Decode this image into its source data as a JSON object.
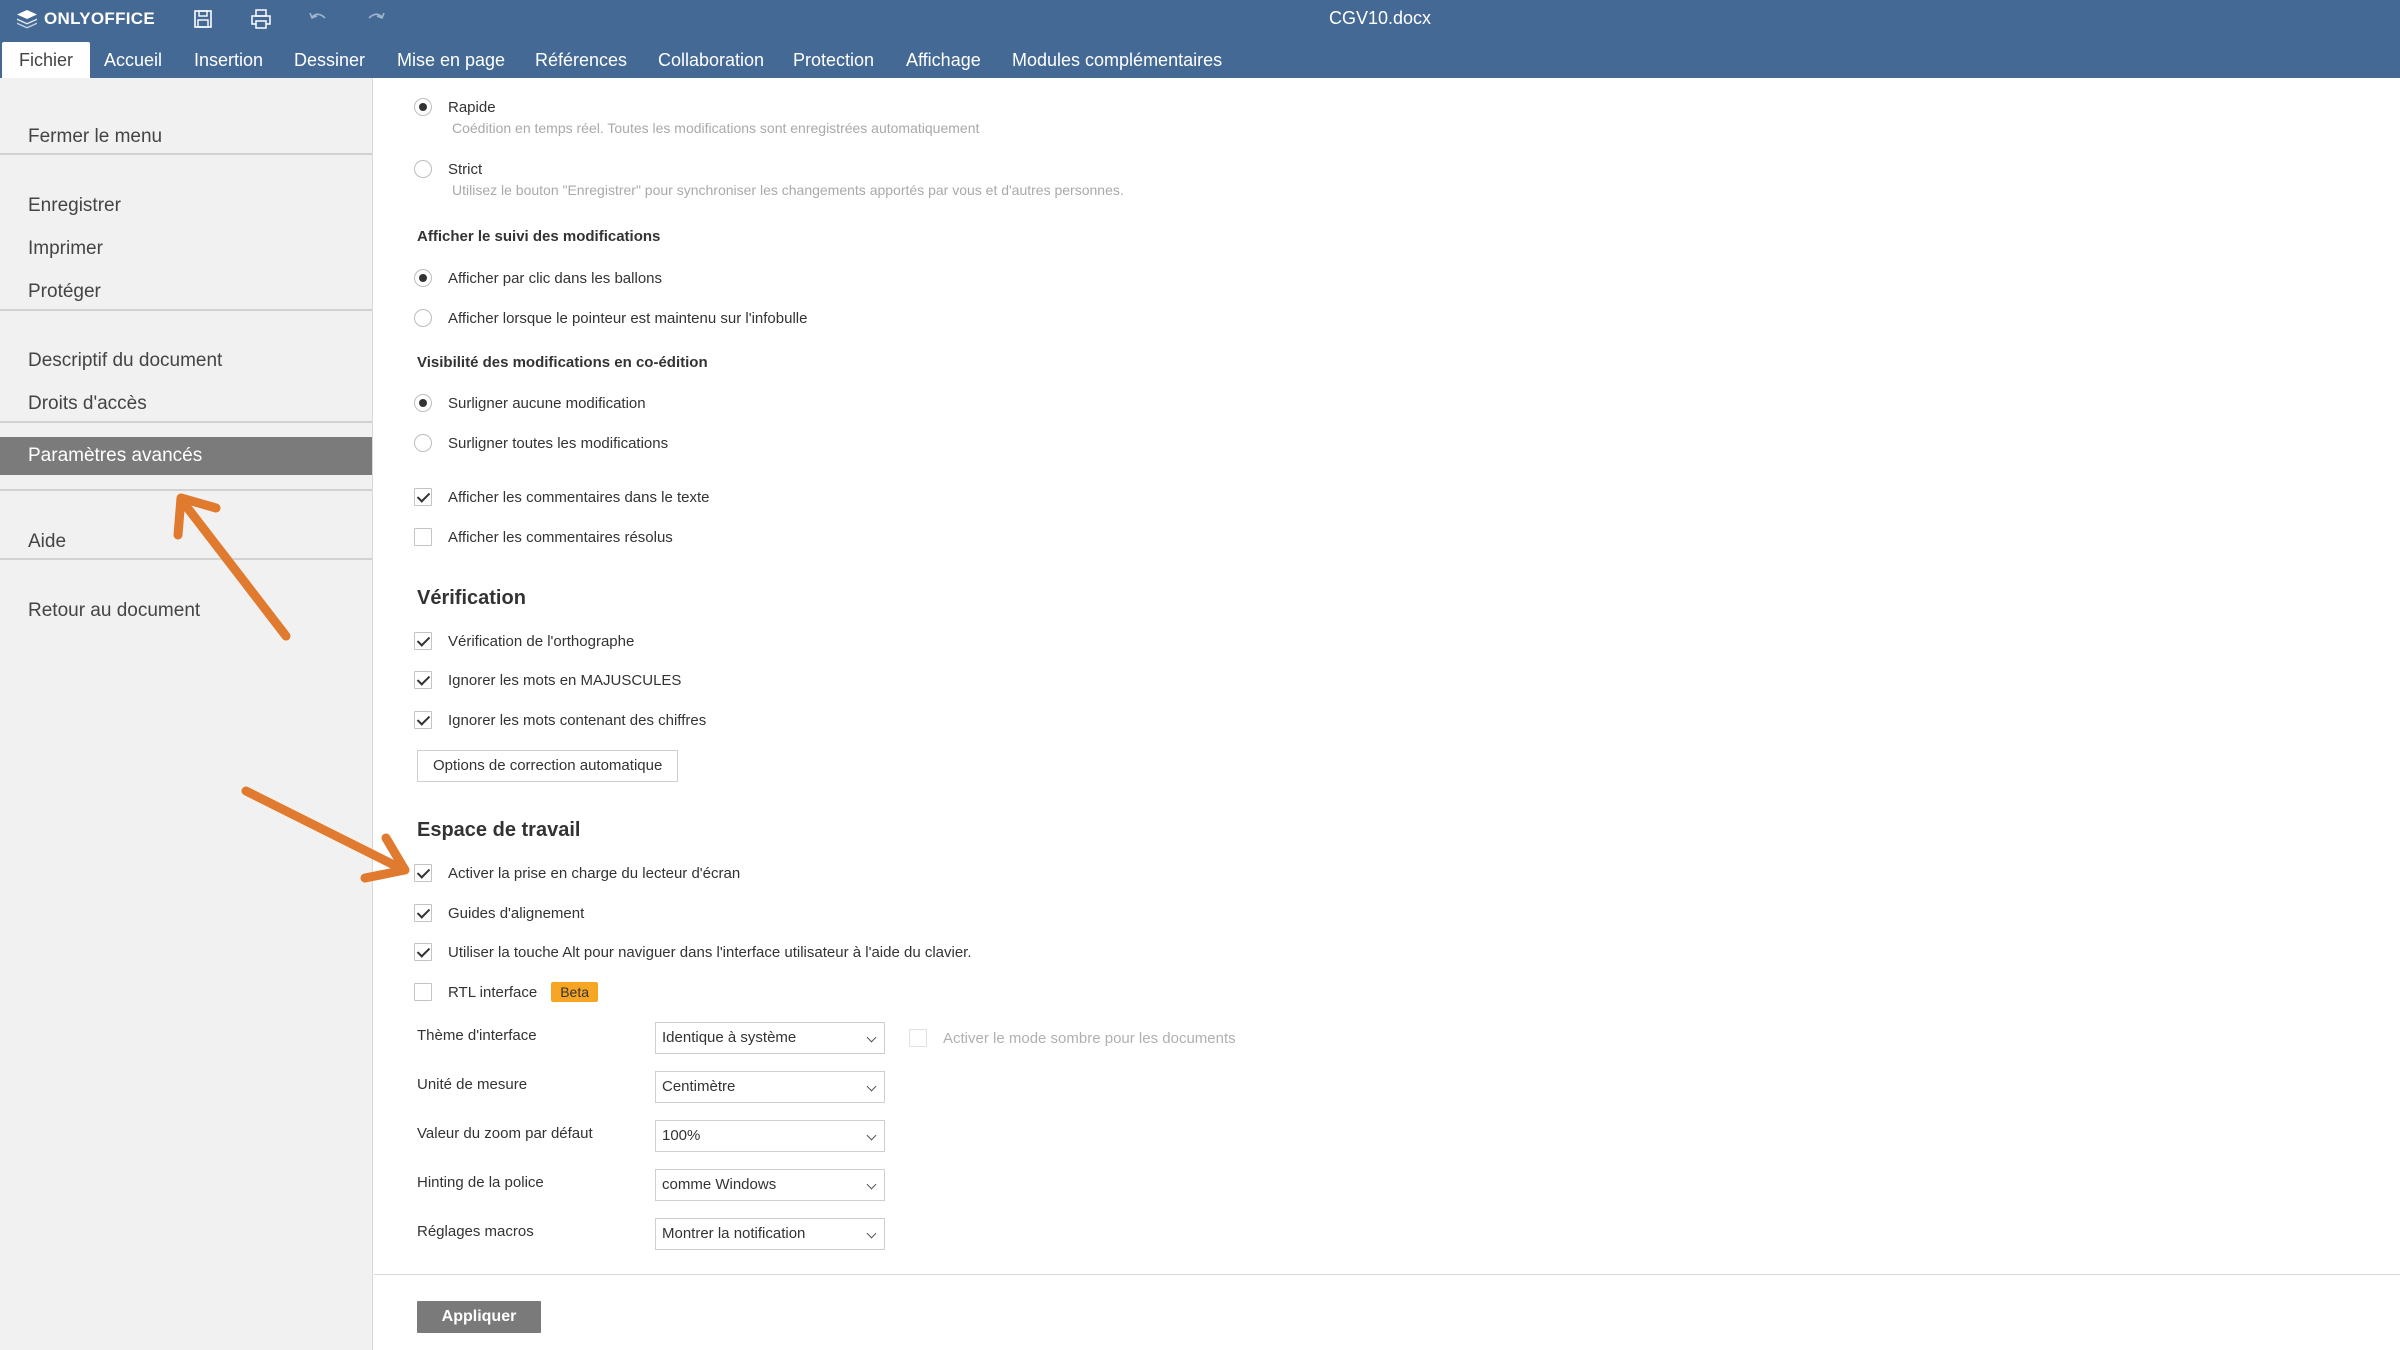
{
  "app": {
    "logo_text": "ONLYOFFICE",
    "document_title": "CGV10.docx",
    "quick_actions": [
      "save-icon",
      "print-icon",
      "undo-icon",
      "redo-icon"
    ]
  },
  "colors": {
    "header": "#446995",
    "menu_active": "#7b7b7b",
    "beta_badge": "#f6a623",
    "annotation_arrow": "#e07a2e"
  },
  "tabs": [
    {
      "label": "Fichier",
      "active": true
    },
    {
      "label": "Accueil"
    },
    {
      "label": "Insertion"
    },
    {
      "label": "Dessiner"
    },
    {
      "label": "Mise en page"
    },
    {
      "label": "Références"
    },
    {
      "label": "Collaboration"
    },
    {
      "label": "Protection"
    },
    {
      "label": "Affichage"
    },
    {
      "label": "Modules complémentaires"
    }
  ],
  "menu": {
    "close": "Fermer le menu",
    "save": "Enregistrer",
    "print": "Imprimer",
    "protect": "Protéger",
    "info": "Descriptif du document",
    "rights": "Droits d'accès",
    "advanced": "Paramètres avancés",
    "help": "Aide",
    "back": "Retour au document"
  },
  "coedit": {
    "fast_label": "Rapide",
    "fast_desc": "Coédition en temps réel. Toutes les modifications sont enregistrées automatiquement",
    "strict_label": "Strict",
    "strict_desc": "Utilisez le bouton \"Enregistrer\" pour synchroniser les changements apportés par vous et d'autres personnes."
  },
  "track_changes": {
    "title": "Afficher le suivi des modifications",
    "balloons": "Afficher par clic dans les ballons",
    "tooltip": "Afficher lorsque le pointeur est maintenu sur l'infobulle"
  },
  "visibility": {
    "title": "Visibilité des modifications en co-édition",
    "none": "Surligner aucune modification",
    "all": "Surligner toutes les modifications"
  },
  "comments": {
    "show": "Afficher les commentaires dans le texte",
    "resolved": "Afficher les commentaires résolus"
  },
  "verification": {
    "title": "Vérification",
    "spelling": "Vérification de l'orthographe",
    "uppercase": "Ignorer les mots en MAJUSCULES",
    "numbers": "Ignorer les mots contenant des chiffres",
    "autocorrect_button": "Options de correction automatique"
  },
  "workspace": {
    "title": "Espace de travail",
    "screen_reader": "Activer la prise en charge du lecteur d'écran",
    "alignment_guides": "Guides d'alignement",
    "alt_key": "Utiliser la touche Alt pour naviguer dans l'interface utilisateur à l'aide du clavier.",
    "rtl": "RTL interface",
    "beta": "Beta",
    "theme_label": "Thème d'interface",
    "theme_value": "Identique à système",
    "dark_mode": "Activer le mode sombre pour les documents",
    "unit_label": "Unité de mesure",
    "unit_value": "Centimètre",
    "zoom_label": "Valeur du zoom par défaut",
    "zoom_value": "100%",
    "hinting_label": "Hinting de la police",
    "hinting_value": "comme Windows",
    "macros_label": "Réglages macros",
    "macros_value": "Montrer la notification"
  },
  "apply_button": "Appliquer"
}
